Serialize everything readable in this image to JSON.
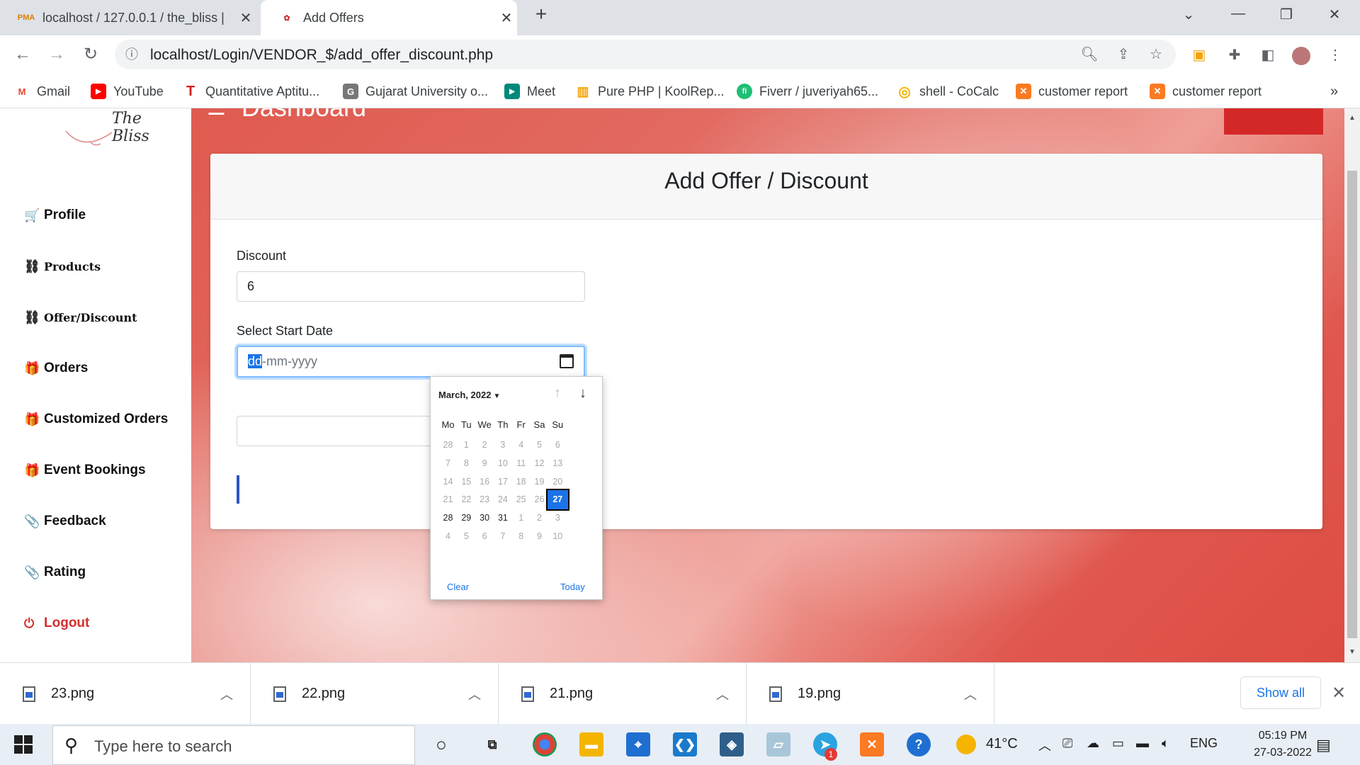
{
  "browser": {
    "tabs": [
      {
        "title": "localhost / 127.0.0.1 / the_bliss | ",
        "favicon": "phpmyadmin-icon",
        "favicon_text": "PMA"
      },
      {
        "title": "Add Offers",
        "favicon": "site-icon"
      }
    ],
    "url": "localhost/Login/VENDOR_$/add_offer_discount.php",
    "bookmarks": [
      {
        "label": "Gmail",
        "icon": "gmail-icon",
        "icon_text": "M",
        "color": "#ea4335"
      },
      {
        "label": "YouTube",
        "icon": "youtube-icon",
        "icon_text": "▶",
        "color": "#ff0000"
      },
      {
        "label": "Quantitative Aptitu...",
        "icon": "indiabix-icon",
        "icon_text": "T",
        "color": "#d71f1f"
      },
      {
        "label": "Gujarat University o...",
        "icon": "gujarat-university-icon",
        "icon_text": "G",
        "color": "#555555"
      },
      {
        "label": "Meet",
        "icon": "meet-icon",
        "icon_text": "▶",
        "color": "#00897b"
      },
      {
        "label": "Pure PHP | KoolRep...",
        "icon": "koolreport-icon",
        "icon_text": "▥",
        "color": "#f4a300"
      },
      {
        "label": "Fiverr / juveriyah65...",
        "icon": "fiverr-icon",
        "icon_text": "fi",
        "color": "#1dbf73"
      },
      {
        "label": "shell - CoCalc",
        "icon": "cocalc-icon",
        "icon_text": "◎",
        "color": "#f4b400"
      },
      {
        "label": "customer report",
        "icon": "xampp-icon",
        "icon_text": "✕",
        "color": "#fb7a24"
      },
      {
        "label": "customer report",
        "icon": "xampp-icon",
        "icon_text": "✕",
        "color": "#fb7a24"
      }
    ],
    "more_bookmarks": "»"
  },
  "sidebar": {
    "logo_text": "The Bliss",
    "items": [
      {
        "label": "Profile",
        "icon": "cart-icon",
        "glyph": "🛒"
      },
      {
        "label": "Products",
        "icon": "sitemap-icon",
        "glyph": "⛓"
      },
      {
        "label": "Offer/Discount",
        "icon": "sitemap-icon",
        "glyph": "⛓"
      },
      {
        "label": "Orders",
        "icon": "gift-icon",
        "glyph": "🎁"
      },
      {
        "label": "Customized Orders",
        "icon": "gift-icon",
        "glyph": "🎁"
      },
      {
        "label": "Event Bookings",
        "icon": "gift-icon",
        "glyph": "🎁"
      },
      {
        "label": "Feedback",
        "icon": "paperclip-icon",
        "glyph": "📎"
      },
      {
        "label": "Rating",
        "icon": "paperclip-icon",
        "glyph": "📎"
      },
      {
        "label": "Logout",
        "icon": "power-icon",
        "glyph": "⏻"
      }
    ]
  },
  "main": {
    "header_title": "Dashboard",
    "card_title": "Add Offer / Discount",
    "discount_label": "Discount",
    "discount_value": "6",
    "start_date_label": "Select Start Date",
    "start_date_placeholder_sel": "dd",
    "start_date_placeholder_rest": "-mm-yyyy"
  },
  "datepicker": {
    "month_label": "March, 2022",
    "weekdays": [
      "Mo",
      "Tu",
      "We",
      "Th",
      "Fr",
      "Sa",
      "Su"
    ],
    "weeks": [
      [
        "28",
        "1",
        "2",
        "3",
        "4",
        "5",
        "6"
      ],
      [
        "7",
        "8",
        "9",
        "10",
        "11",
        "12",
        "13"
      ],
      [
        "14",
        "15",
        "16",
        "17",
        "18",
        "19",
        "20"
      ],
      [
        "21",
        "22",
        "23",
        "24",
        "25",
        "26",
        "27"
      ],
      [
        "28",
        "29",
        "30",
        "31",
        "1",
        "2",
        "3"
      ],
      [
        "4",
        "5",
        "6",
        "7",
        "8",
        "9",
        "10"
      ]
    ],
    "selected_day": "27",
    "clear_label": "Clear",
    "today_label": "Today"
  },
  "downloads": {
    "files": [
      "23.png",
      "22.png",
      "21.png",
      "19.png"
    ],
    "show_all": "Show all"
  },
  "taskbar": {
    "search_placeholder": "Type here to search",
    "temperature": "41°C",
    "language": "ENG",
    "time": "05:19 PM",
    "date": "27-03-2022",
    "badge": "1"
  }
}
